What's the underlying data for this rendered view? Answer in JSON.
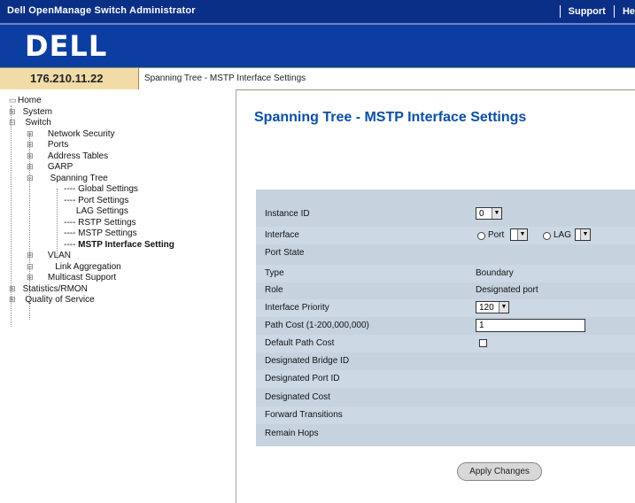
{
  "app": {
    "title": "Dell OpenManage Switch Administrator",
    "support_label": "Support",
    "help_label": "He"
  },
  "logo": {
    "text": "DELL"
  },
  "infobar": {
    "ip": "176.210.11.22",
    "breadcrumb": "Spanning Tree - MSTP Interface Settings"
  },
  "sidebar": {
    "items": [
      {
        "label": "Home",
        "glyph": "▭"
      },
      {
        "label": "System",
        "glyph": "⊞"
      },
      {
        "label": "Switch",
        "glyph": "⊟"
      },
      {
        "label": "Network Security",
        "glyph": "⊞"
      },
      {
        "label": "Ports",
        "glyph": "⊞"
      },
      {
        "label": "Address Tables",
        "glyph": "⊞"
      },
      {
        "label": "GARP",
        "glyph": "⊞"
      },
      {
        "label": "Spanning Tree",
        "glyph": "⊟"
      },
      {
        "label": "Global Settings",
        "glyph": ""
      },
      {
        "label": "Port Settings",
        "glyph": ""
      },
      {
        "label": "LAG Settings",
        "glyph": ""
      },
      {
        "label": "RSTP Settings",
        "glyph": ""
      },
      {
        "label": "MSTP Settings",
        "glyph": ""
      },
      {
        "label": "MSTP Interface Setting",
        "glyph": ""
      },
      {
        "label": "VLAN",
        "glyph": "⊞"
      },
      {
        "label": "Link Aggregation",
        "glyph": "⊟"
      },
      {
        "label": "Multicast Support",
        "glyph": "⊞"
      },
      {
        "label": "Statistics/RMON",
        "glyph": "⊞"
      },
      {
        "label": "Quality of Service",
        "glyph": "⊞"
      }
    ]
  },
  "main": {
    "title": "Spanning Tree - MSTP Interface Settings",
    "labels": {
      "instance_id": "Instance ID",
      "interface": "Interface",
      "port_state": "Port State",
      "type": "Type",
      "role": "Role",
      "interface_priority": "Interface Priority",
      "path_cost": "Path Cost (1-200,000,000)",
      "default_path_cost": "Default Path Cost",
      "designated_bridge_id": "Designated Bridge ID",
      "designated_port_id": "Designated Port ID",
      "designated_cost": "Designated Cost",
      "forward_transitions": "Forward Transitions",
      "remain_hops": "Remain Hops"
    },
    "values": {
      "instance_id": "0",
      "port_option": "Port",
      "lag_option": "LAG",
      "type": "Boundary",
      "role": "Designated port",
      "interface_priority": "120",
      "path_cost": "1"
    },
    "apply_label": "Apply Changes"
  }
}
